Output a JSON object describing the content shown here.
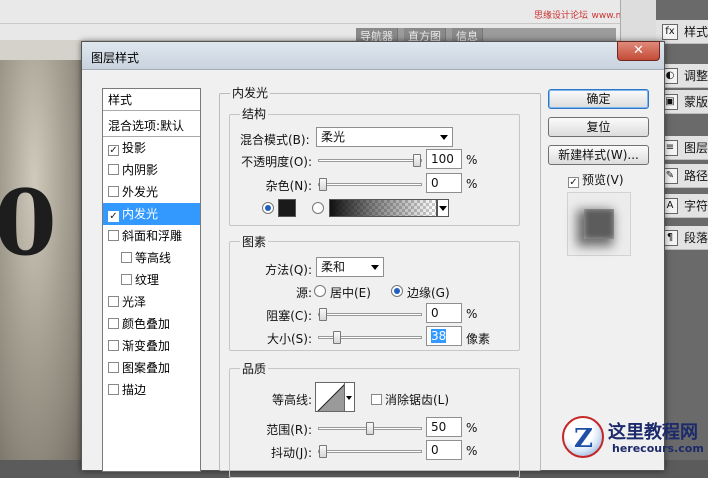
{
  "background": {
    "watermark_top": "思缘设计论坛",
    "watermark_top_url": "www.missyuan.com",
    "panel_tabs": [
      "导航器",
      "直方图",
      "信息"
    ],
    "right_panel": [
      "样式",
      "调整",
      "蒙版",
      "图层",
      "路径",
      "字符",
      "段落"
    ]
  },
  "dialog": {
    "title": "图层样式",
    "close": "✕"
  },
  "styles_list": {
    "header": "样式",
    "blend_default": "混合选项:默认",
    "items": [
      {
        "label": "投影",
        "checked": true,
        "indent": false
      },
      {
        "label": "内阴影",
        "checked": false,
        "indent": false
      },
      {
        "label": "外发光",
        "checked": false,
        "indent": false
      },
      {
        "label": "内发光",
        "checked": true,
        "indent": false,
        "selected": true
      },
      {
        "label": "斜面和浮雕",
        "checked": false,
        "indent": false
      },
      {
        "label": "等高线",
        "checked": false,
        "indent": true
      },
      {
        "label": "纹理",
        "checked": false,
        "indent": true
      },
      {
        "label": "光泽",
        "checked": false,
        "indent": false
      },
      {
        "label": "颜色叠加",
        "checked": false,
        "indent": false
      },
      {
        "label": "渐变叠加",
        "checked": false,
        "indent": false
      },
      {
        "label": "图案叠加",
        "checked": false,
        "indent": false
      },
      {
        "label": "描边",
        "checked": false,
        "indent": false
      }
    ]
  },
  "inner_glow": {
    "section_title": "内发光",
    "structure": {
      "title": "结构",
      "blend_mode_label": "混合模式(B):",
      "blend_mode_value": "柔光",
      "opacity_label": "不透明度(O):",
      "opacity_value": "100",
      "opacity_level": 1.0,
      "noise_label": "杂色(N):",
      "noise_value": "0",
      "noise_level": 0.0,
      "percent": "%"
    },
    "elements": {
      "title": "图素",
      "technique_label": "方法(Q):",
      "technique_value": "柔和",
      "source_label": "源:",
      "source_center": "居中(E)",
      "source_edge": "边缘(G)",
      "choke_label": "阻塞(C):",
      "choke_value": "0",
      "choke_level": 0.0,
      "size_label": "大小(S):",
      "size_value": "38",
      "size_level": 0.15,
      "size_unit": "像素",
      "percent": "%"
    },
    "quality": {
      "title": "品质",
      "contour_label": "等高线:",
      "antialias_label": "消除锯齿(L)",
      "range_label": "范围(R):",
      "range_value": "50",
      "range_level": 0.5,
      "jitter_label": "抖动(J):",
      "jitter_value": "0",
      "jitter_level": 0.0,
      "percent": "%"
    }
  },
  "buttons": {
    "ok": "确定",
    "reset": "复位",
    "new_style": "新建样式(W)...",
    "preview": "预览(V)"
  },
  "watermark_logo": {
    "letter": "Z",
    "name": "这里教程网",
    "url": "herecours.com"
  },
  "colors": {
    "selection": "#3399ff",
    "glow_color": "#1a1a1a"
  }
}
